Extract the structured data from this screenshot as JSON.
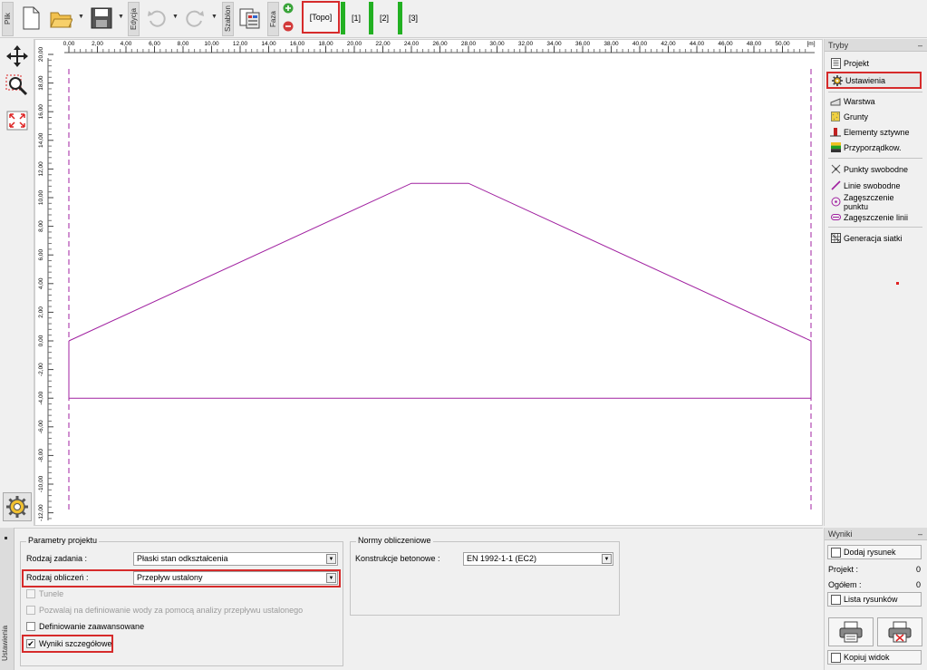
{
  "toolbar": {
    "labels": {
      "plik": "Plik",
      "edycja": "Edycja",
      "szablon": "Szablon",
      "faza": "Faza"
    },
    "phases": [
      "[Topo]",
      "[1]",
      "[2]",
      "[3]"
    ],
    "selected_phase": "[Topo]",
    "icons": [
      "new-file-icon",
      "open-folder-icon",
      "save-icon",
      "undo-icon",
      "redo-icon",
      "template-icon",
      "add-phase-icon",
      "remove-phase-icon"
    ]
  },
  "left_tools": [
    "move-icon",
    "zoom-icon",
    "fit-view-icon",
    "settings-gear-icon"
  ],
  "canvas": {
    "x_unit": "[m]",
    "x_ticks": [
      "0,00",
      "2,00",
      "4,00",
      "6,00",
      "8,00",
      "10,00",
      "12,00",
      "14,00",
      "16,00",
      "18,00",
      "20,00",
      "22,00",
      "24,00",
      "26,00",
      "28,00",
      "30,00",
      "32,00",
      "34,00",
      "36,00",
      "38,00",
      "40,00",
      "42,00",
      "44,00",
      "46,00",
      "48,00",
      "50,00"
    ],
    "y_ticks": [
      "20,00",
      "18,00",
      "16,00",
      "14,00",
      "12,00",
      "10,00",
      "8,00",
      "6,00",
      "4,00",
      "2,00",
      "0,00",
      "-2,00",
      "-4,00",
      "-6,00",
      "-8,00",
      "-10,00",
      "-12,00"
    ],
    "profile_color": "#a020a0",
    "profile_points": [
      [
        0,
        0
      ],
      [
        24,
        11
      ],
      [
        28,
        11
      ],
      [
        52,
        0
      ],
      [
        52,
        -4
      ],
      [
        0,
        -4
      ],
      [
        0,
        0
      ]
    ]
  },
  "right_panel": {
    "title": "Tryby",
    "minimize": "–",
    "items": [
      {
        "label": "Projekt",
        "icon": "project-icon"
      },
      {
        "label": "Ustawienia",
        "icon": "settings-icon",
        "highlighted": true
      },
      {
        "label": "Warstwa",
        "icon": "layer-icon"
      },
      {
        "label": "Grunty",
        "icon": "soils-icon"
      },
      {
        "label": "Elementy sztywne",
        "icon": "rigid-elements-icon"
      },
      {
        "label": "Przyporządkow.",
        "icon": "assignment-icon"
      },
      {
        "label": "Punkty swobodne",
        "icon": "free-points-icon"
      },
      {
        "label": "Linie swobodne",
        "icon": "free-lines-icon"
      },
      {
        "label": "Zagęszczenie punktu",
        "icon": "point-refinement-icon"
      },
      {
        "label": "Zagęszczenie linii",
        "icon": "line-refinement-icon"
      },
      {
        "label": "Generacja siatki",
        "icon": "mesh-generation-icon"
      }
    ]
  },
  "bottom": {
    "tab_label": "Ustawienia",
    "project_params": {
      "title": "Parametry projektu",
      "task_label": "Rodzaj zadania :",
      "task_value": "Płaski stan odkształcenia",
      "calc_label": "Rodzaj obliczeń :",
      "calc_value": "Przepływ ustalony",
      "checkboxes": [
        {
          "label": "Tunele",
          "checked": false,
          "disabled": true
        },
        {
          "label": "Pozwalaj na definiowanie wody za pomocą analizy przepływu ustalonego",
          "checked": false,
          "disabled": true
        },
        {
          "label": "Definiowanie zaawansowane",
          "checked": false,
          "disabled": false
        },
        {
          "label": "Wyniki szczegółowe",
          "checked": true,
          "disabled": false
        }
      ]
    },
    "norms": {
      "title": "Normy obliczeniowe",
      "concrete_label": "Konstrukcje betonowe :",
      "concrete_value": "EN 1992-1-1 (EC2)"
    }
  },
  "results": {
    "title": "Wyniki",
    "minimize": "–",
    "add_drawing": "Dodaj rysunek",
    "project_label": "Projekt :",
    "project_count": "0",
    "total_label": "Ogółem :",
    "total_count": "0",
    "list_drawings": "Lista rysunków",
    "copy_view": "Kopiuj widok"
  }
}
